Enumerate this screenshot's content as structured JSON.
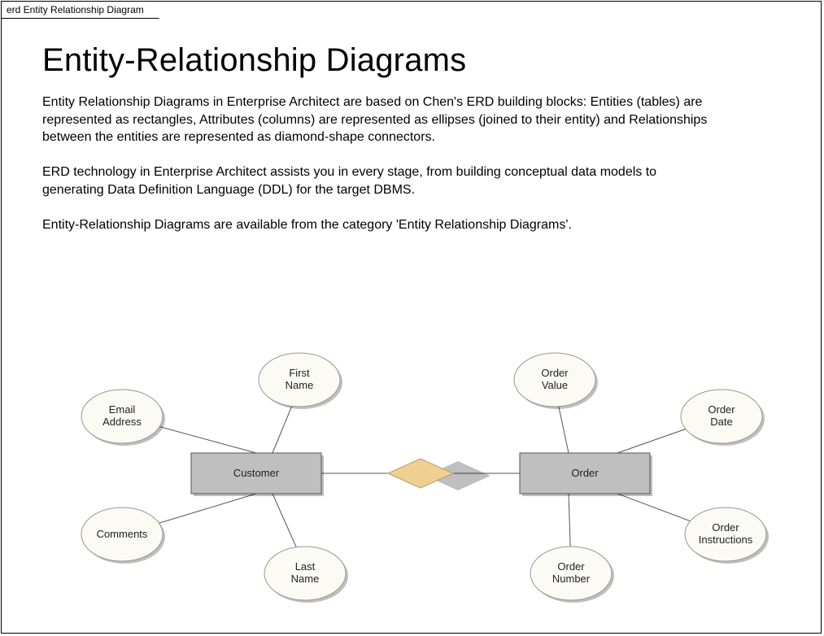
{
  "tab_label": "erd Entity Relationship Diagram",
  "title": "Entity-Relationship Diagrams",
  "paragraph": "Entity Relationship Diagrams in Enterprise Architect are based on Chen's ERD building blocks: Entities (tables) are represented as rectangles, Attributes (columns) are represented as ellipses (joined to their entity) and Relationships between the entities are represented as diamond-shape connectors.\n\nERD technology in Enterprise Architect assists you in every stage, from building conceptual data models to generating Data Definition Language (DDL) for the target DBMS.\n\nEntity-Relationship Diagrams are available from the category 'Entity Relationship Diagrams'.",
  "diagram": {
    "entities": {
      "customer": "Customer",
      "order": "Order"
    },
    "relationship": "",
    "attributes": {
      "customer": {
        "first_name_l1": "First",
        "first_name_l2": "Name",
        "email_l1": "Email",
        "email_l2": "Address",
        "comments": "Comments",
        "last_name_l1": "Last",
        "last_name_l2": "Name"
      },
      "order": {
        "value_l1": "Order",
        "value_l2": "Value",
        "date_l1": "Order",
        "date_l2": "Date",
        "instructions_l1": "Order",
        "instructions_l2": "Instructions",
        "number_l1": "Order",
        "number_l2": "Number"
      }
    }
  }
}
